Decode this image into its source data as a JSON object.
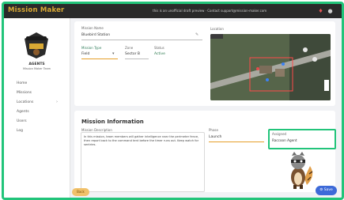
{
  "app": {
    "brand": "Mission Maker",
    "notice": "this is an unofficial draft preview · Contact support@mission-maker.com"
  },
  "sidebar": {
    "org_name": "AGENTS",
    "org_sub": "Mission Maker Team",
    "items": [
      {
        "label": "Home"
      },
      {
        "label": "Missions"
      },
      {
        "label": "Locations"
      },
      {
        "label": "Agents"
      },
      {
        "label": "Users"
      },
      {
        "label": "Log"
      }
    ]
  },
  "mission": {
    "name_label": "Mission Name",
    "name_value": "Bluebird Station",
    "type_label": "Mission Type",
    "type_value": "Field",
    "zone_label": "Zone",
    "zone_value": "Sector B",
    "status_label": "Status",
    "status_value": "Active",
    "map_label": "Location"
  },
  "info": {
    "title": "Mission Information",
    "description_label": "Mission Description",
    "description_text": "In this mission, team members will gather intelligence near the perimeter fence, then report back to the command tent before the timer runs out. Keep watch for sentries.",
    "phase_label": "Phase",
    "phase_value": "Launch",
    "assigned_label": "Assigned",
    "assigned_value": "Raccoon Agent"
  },
  "buttons": {
    "back": "Back",
    "save": "Save"
  },
  "colors": {
    "accent": "#22c47a",
    "brand": "#d9a934",
    "primary": "#3d6ad8"
  }
}
